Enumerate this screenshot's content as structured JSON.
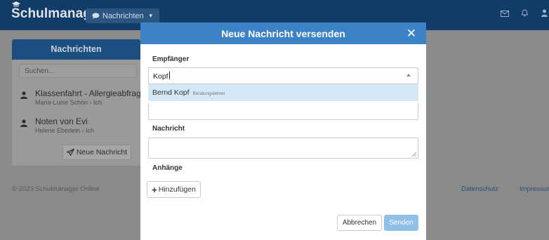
{
  "app": {
    "brand": "Schulmanager",
    "nav_label": "Nachrichten",
    "footer_copyright": "© 2023 Schulmanager Online",
    "footer_links": [
      "Datenschutz",
      "Impressum"
    ]
  },
  "panel": {
    "title": "Nachrichten",
    "search_placeholder": "Suchen...",
    "conversations": [
      {
        "subject": "Klassenfahrt - Allergieabfrage",
        "participants": "Maria-Luise Schön › Ich"
      },
      {
        "subject": "Noten von Evi",
        "participants": "Helene Eberlein › Ich"
      }
    ],
    "new_message_label": "Neue Nachricht"
  },
  "modal": {
    "title": "Neue Nachricht versenden",
    "recipient_label": "Empfänger",
    "recipient_input": "Kopf",
    "suggestion": {
      "name": "Bernd Kopf",
      "role": "Beratungslehrer"
    },
    "message_label": "Nachricht",
    "attachments_label": "Anhänge",
    "add_label": "Hinzufügen",
    "cancel_label": "Abbrechen",
    "send_label": "Senden"
  },
  "colors": {
    "header": "#3d82c7",
    "topbar": "#123c68",
    "suggestion_highlight": "#d5e8f8",
    "send_button": "#8fc1e8"
  },
  "icons": [
    "graduation-cap-icon",
    "chat-bubble-icon",
    "chevron-down-icon",
    "mail-icon",
    "bell-icon",
    "user-icon",
    "person-icon",
    "send-icon",
    "close-icon",
    "caret-up-icon",
    "plus-icon",
    "resize-grip-icon"
  ]
}
